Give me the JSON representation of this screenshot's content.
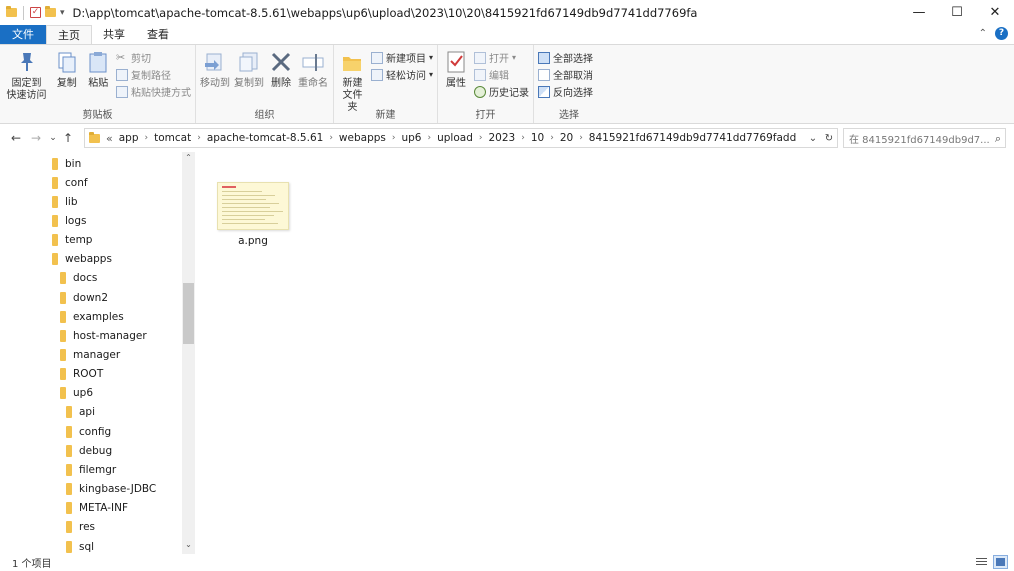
{
  "titlebar": {
    "path": "D:\\app\\tomcat\\apache-tomcat-8.5.61\\webapps\\up6\\upload\\2023\\10\\20\\8415921fd67149db9d7741dd7769fa",
    "minimize": "—",
    "maximize": "☐",
    "close": "✕"
  },
  "tabs": {
    "file": "文件",
    "home": "主页",
    "share": "共享",
    "view": "查看"
  },
  "ribbon": {
    "clipboard": {
      "label": "剪贴板",
      "pin_line1": "固定到",
      "pin_line2": "快速访问",
      "copy": "复制",
      "paste": "粘贴",
      "cut": "剪切",
      "copy_path": "复制路径",
      "paste_shortcut": "粘贴快捷方式"
    },
    "organize": {
      "label": "组织",
      "move_to": "移动到",
      "copy_to": "复制到",
      "delete": "删除",
      "rename": "重命名"
    },
    "new": {
      "label": "新建",
      "new_folder_line1": "新建",
      "new_folder_line2": "文件夹",
      "new_item": "新建项目",
      "easy_access": "轻松访问"
    },
    "open": {
      "label": "打开",
      "properties": "属性",
      "open": "打开",
      "edit": "编辑",
      "history": "历史记录"
    },
    "select": {
      "label": "选择",
      "select_all": "全部选择",
      "select_none": "全部取消",
      "invert": "反向选择"
    }
  },
  "address": {
    "prefix": "«",
    "crumbs": [
      "app",
      "tomcat",
      "apache-tomcat-8.5.61",
      "webapps",
      "up6",
      "upload",
      "2023",
      "10",
      "20",
      "8415921fd67149db9d7741dd7769fadd"
    ],
    "search_placeholder": "在 8415921fd67149db9d7..."
  },
  "nav_tree": [
    {
      "label": "bin",
      "level": 0
    },
    {
      "label": "conf",
      "level": 0
    },
    {
      "label": "lib",
      "level": 0
    },
    {
      "label": "logs",
      "level": 0
    },
    {
      "label": "temp",
      "level": 0
    },
    {
      "label": "webapps",
      "level": 0
    },
    {
      "label": "docs",
      "level": 1
    },
    {
      "label": "down2",
      "level": 1
    },
    {
      "label": "examples",
      "level": 1
    },
    {
      "label": "host-manager",
      "level": 1
    },
    {
      "label": "manager",
      "level": 1
    },
    {
      "label": "ROOT",
      "level": 1
    },
    {
      "label": "up6",
      "level": 1
    },
    {
      "label": "api",
      "level": 2
    },
    {
      "label": "config",
      "level": 2
    },
    {
      "label": "debug",
      "level": 2
    },
    {
      "label": "filemgr",
      "level": 2
    },
    {
      "label": "kingbase-JDBC",
      "level": 2
    },
    {
      "label": "META-INF",
      "level": 2
    },
    {
      "label": "res",
      "level": 2
    },
    {
      "label": "sql",
      "level": 2
    }
  ],
  "files": [
    {
      "name": "a.png"
    }
  ],
  "status": {
    "count": "1 个项目"
  },
  "colors": {
    "accent": "#1a6fc4",
    "folder": "#f2c14e"
  }
}
